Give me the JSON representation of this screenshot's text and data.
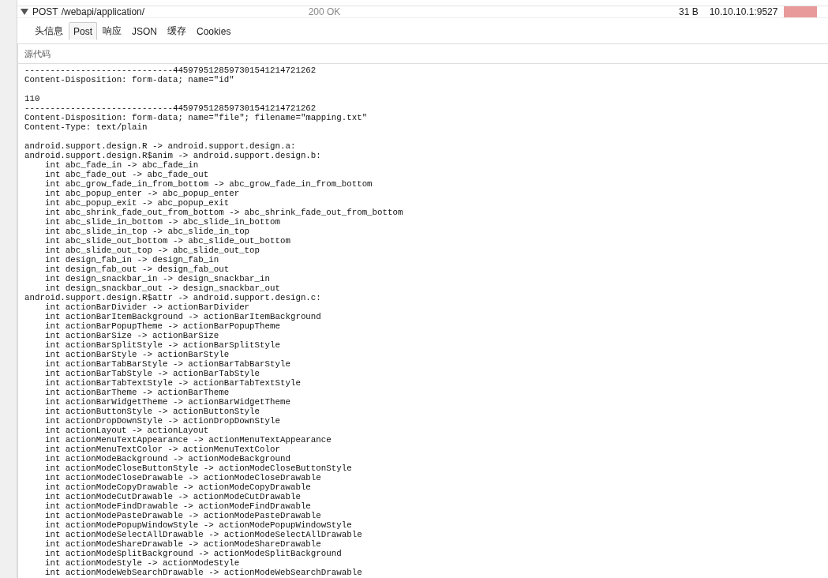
{
  "request": {
    "expanded": true,
    "method": "POST",
    "url": "/webapi/application/",
    "status": "200 OK",
    "size": "31 B",
    "remote": "10.10.10.1:9527"
  },
  "tabs": [
    {
      "label": "头信息",
      "selected": false
    },
    {
      "label": "Post",
      "selected": true
    },
    {
      "label": "响应",
      "selected": false
    },
    {
      "label": "JSON",
      "selected": false
    },
    {
      "label": "缓存",
      "selected": false
    },
    {
      "label": "Cookies",
      "selected": false
    }
  ],
  "source": {
    "title": "源代码",
    "blocks": [
      [
        "-----------------------------4459795128597301541214721262",
        "Content-Disposition: form-data; name=\"id\""
      ],
      [
        "110",
        "-----------------------------4459795128597301541214721262",
        "Content-Disposition: form-data; name=\"file\"; filename=\"mapping.txt\"",
        "Content-Type: text/plain"
      ],
      [
        "android.support.design.R -> android.support.design.a:",
        "android.support.design.R$anim -> android.support.design.b:",
        "    int abc_fade_in -> abc_fade_in",
        "    int abc_fade_out -> abc_fade_out",
        "    int abc_grow_fade_in_from_bottom -> abc_grow_fade_in_from_bottom",
        "    int abc_popup_enter -> abc_popup_enter",
        "    int abc_popup_exit -> abc_popup_exit",
        "    int abc_shrink_fade_out_from_bottom -> abc_shrink_fade_out_from_bottom",
        "    int abc_slide_in_bottom -> abc_slide_in_bottom",
        "    int abc_slide_in_top -> abc_slide_in_top",
        "    int abc_slide_out_bottom -> abc_slide_out_bottom",
        "    int abc_slide_out_top -> abc_slide_out_top",
        "    int design_fab_in -> design_fab_in",
        "    int design_fab_out -> design_fab_out",
        "    int design_snackbar_in -> design_snackbar_in",
        "    int design_snackbar_out -> design_snackbar_out",
        "android.support.design.R$attr -> android.support.design.c:",
        "    int actionBarDivider -> actionBarDivider",
        "    int actionBarItemBackground -> actionBarItemBackground",
        "    int actionBarPopupTheme -> actionBarPopupTheme",
        "    int actionBarSize -> actionBarSize",
        "    int actionBarSplitStyle -> actionBarSplitStyle",
        "    int actionBarStyle -> actionBarStyle",
        "    int actionBarTabBarStyle -> actionBarTabBarStyle",
        "    int actionBarTabStyle -> actionBarTabStyle",
        "    int actionBarTabTextStyle -> actionBarTabTextStyle",
        "    int actionBarTheme -> actionBarTheme",
        "    int actionBarWidgetTheme -> actionBarWidgetTheme",
        "    int actionButtonStyle -> actionButtonStyle",
        "    int actionDropDownStyle -> actionDropDownStyle",
        "    int actionLayout -> actionLayout",
        "    int actionMenuTextAppearance -> actionMenuTextAppearance",
        "    int actionMenuTextColor -> actionMenuTextColor",
        "    int actionModeBackground -> actionModeBackground",
        "    int actionModeCloseButtonStyle -> actionModeCloseButtonStyle",
        "    int actionModeCloseDrawable -> actionModeCloseDrawable",
        "    int actionModeCopyDrawable -> actionModeCopyDrawable",
        "    int actionModeCutDrawable -> actionModeCutDrawable",
        "    int actionModeFindDrawable -> actionModeFindDrawable",
        "    int actionModePasteDrawable -> actionModePasteDrawable",
        "    int actionModePopupWindowStyle -> actionModePopupWindowStyle",
        "    int actionModeSelectAllDrawable -> actionModeSelectAllDrawable",
        "    int actionModeShareDrawable -> actionModeShareDrawable",
        "    int actionModeSplitBackground -> actionModeSplitBackground",
        "    int actionModeStyle -> actionModeStyle",
        "    int actionModeWebSearchDrawable -> actionModeWebSearchDrawable"
      ]
    ]
  }
}
